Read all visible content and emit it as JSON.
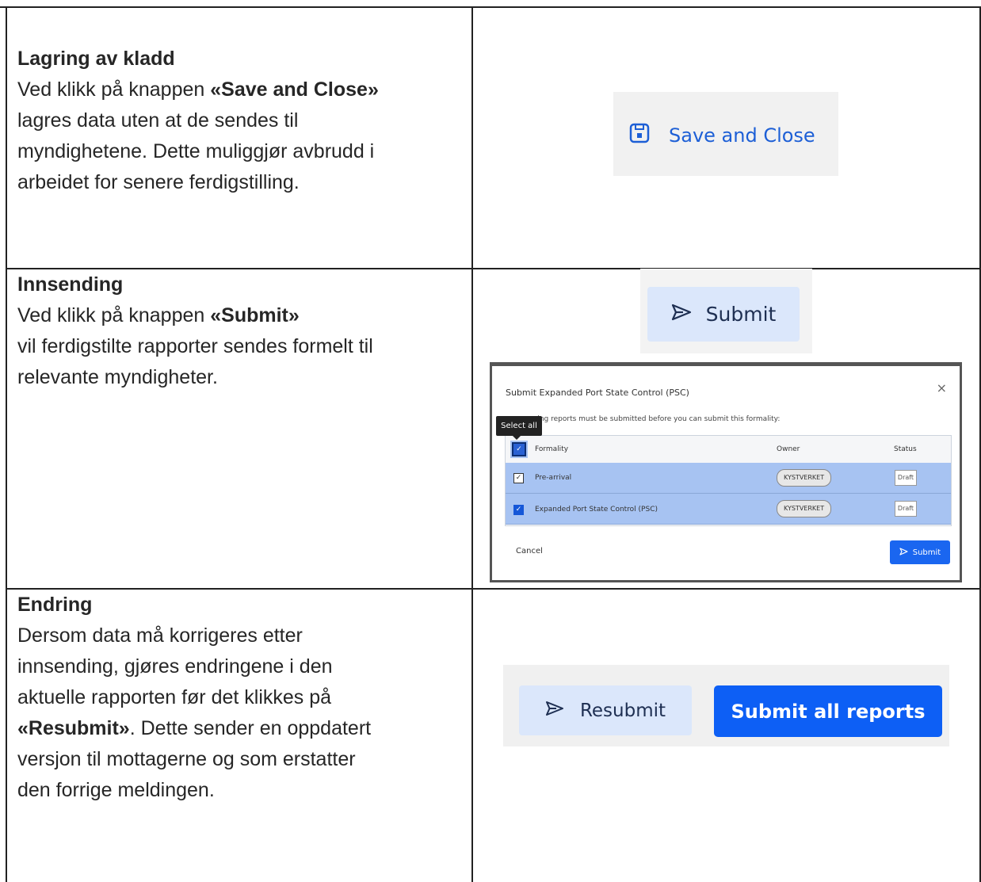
{
  "rows": [
    {
      "heading": "Lagring av kladd",
      "line1_pre": "Ved klikk på knappen ",
      "line1_bold": "«Save and Close»",
      "line2": "lagres data uten at de sendes til",
      "line3": "myndighetene. Dette muliggjør avbrudd i",
      "line4": "arbeidet for senere ferdigstilling."
    },
    {
      "heading": "Innsending",
      "line1_pre": "Ved klikk på knappen ",
      "line1_bold": "«Submit»",
      "line2": "vil ferdigstilte rapporter sendes formelt til",
      "line3": "relevante myndigheter."
    },
    {
      "heading": "Endring",
      "line1": "Dersom data må korrigeres etter",
      "line2": "innsending, gjøres endringene i den",
      "line3": "aktuelle rapporten før det klikkes på",
      "line4_bold": "«Resubmit»",
      "line4_post": ". Dette sender en oppdatert",
      "line5": "versjon til mottagerne og som erstatter",
      "line6": "den forrige meldingen."
    }
  ],
  "save_shot": {
    "label": "Save and Close",
    "icon": "save-icon"
  },
  "submit_shot": {
    "label": "Submit",
    "icon": "send-icon"
  },
  "dialog": {
    "title": "Submit Expanded Port State Control (PSC)",
    "close": "×",
    "subtitle": "ving reports must be submitted before you can submit this formality:",
    "tooltip": "Select all",
    "headers": {
      "formality": "Formality",
      "owner": "Owner",
      "status": "Status"
    },
    "rows": [
      {
        "formality": "Pre-arrival",
        "owner": "KYSTVERKET",
        "status": "Draft",
        "checked": true
      },
      {
        "formality": "Expanded Port State Control (PSC)",
        "owner": "KYSTVERKET",
        "status": "Draft",
        "checked": true
      }
    ],
    "cancel": "Cancel",
    "submit": "Submit",
    "accent": "#1a66f0"
  },
  "resubmit_shot": {
    "resubmit": "Resubmit",
    "submit_all": "Submit all reports",
    "accent": "#0d5ff5"
  }
}
